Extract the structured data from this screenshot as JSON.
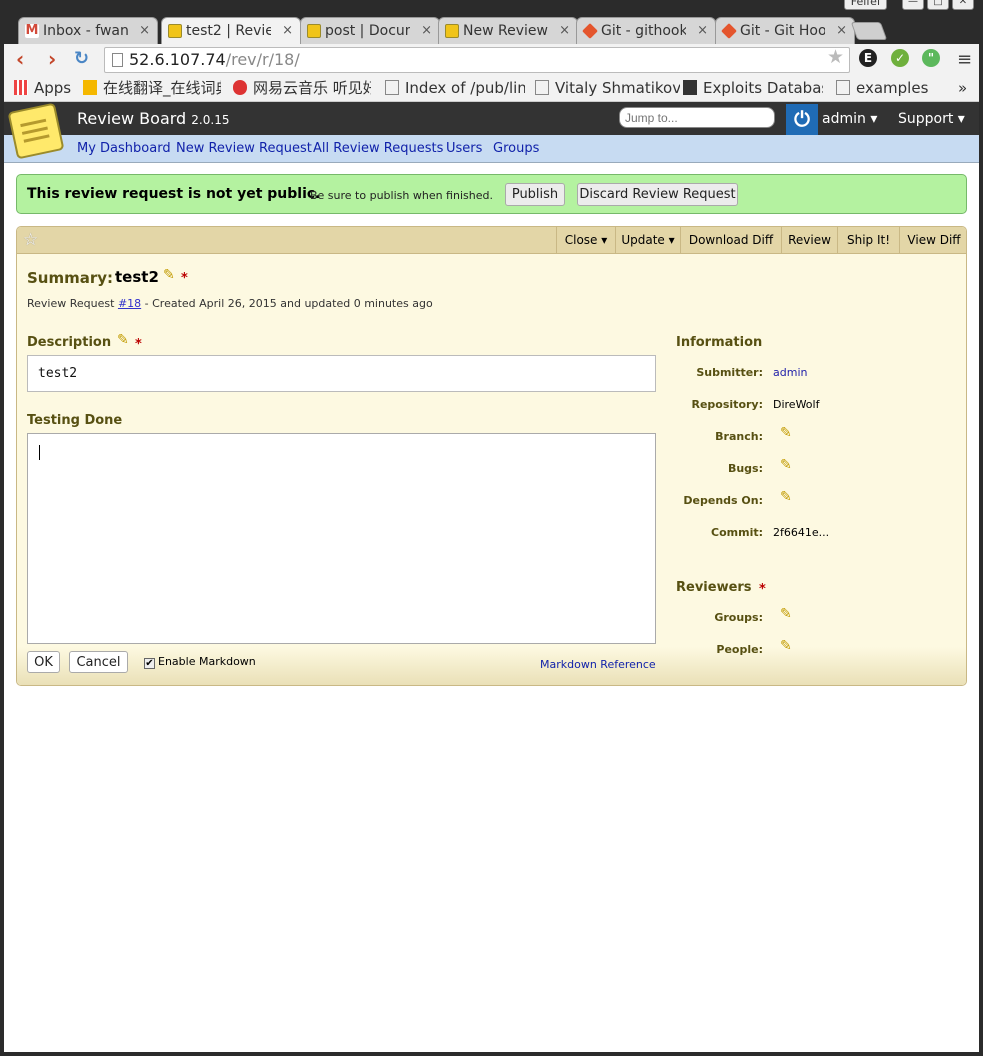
{
  "browser": {
    "window_user": "Feifei",
    "tabs": [
      {
        "title": "Inbox - fwan",
        "favicon_color": "#d24a3a",
        "favicon": "M"
      },
      {
        "title": "test2 | Revie",
        "favicon_color": "#f0c419",
        "favicon": ""
      },
      {
        "title": "post | Docum",
        "favicon_color": "#f0c419",
        "favicon": ""
      },
      {
        "title": "New Review",
        "favicon_color": "#f0c419",
        "favicon": ""
      },
      {
        "title": "Git - githook",
        "favicon_color": "#e4552d",
        "favicon": ""
      },
      {
        "title": "Git - Git Hoo",
        "favicon_color": "#e4552d",
        "favicon": ""
      }
    ],
    "close_glyph": "×",
    "url_host": "52.6.107.74",
    "url_path": "/rev/r/18/",
    "bookmarks": [
      "Apps",
      "在线翻译_在线词典",
      "网易云音乐 听见好",
      "Index of /pub/lin",
      "Vitaly Shmatikov",
      "Exploits Databas",
      "examples"
    ],
    "bookmarks_more": "»"
  },
  "header": {
    "app_name": "Review Board",
    "version": "2.0.15",
    "jump_placeholder": "Jump to...",
    "user_menu": "admin ▾",
    "support_menu": "Support ▾"
  },
  "nav": [
    "My Dashboard",
    "New Review Request",
    "All Review Requests",
    "Users",
    "Groups"
  ],
  "banner": {
    "title": "This review request is not yet public.",
    "subtitle": "Be sure to publish when finished.",
    "publish": "Publish",
    "discard": "Discard Review Request"
  },
  "actions": [
    "Close ▾",
    "Update ▾",
    "Download Diff",
    "Review",
    "Ship It!",
    "View Diff"
  ],
  "summary": {
    "label": "Summary:",
    "value": "test2",
    "required": "*",
    "rr_prefix": "Review Request",
    "rr_id": "#18",
    "rr_suffix": "- Created April 26, 2015 and updated 0 minutes ago"
  },
  "description": {
    "label": "Description",
    "required": "*",
    "value": "test2"
  },
  "testing": {
    "label": "Testing Done",
    "value": "",
    "ok": "OK",
    "cancel": "Cancel",
    "markdown": "Enable Markdown",
    "markdown_checked": "✔",
    "markdown_ref": "Markdown Reference"
  },
  "information": {
    "title": "Information",
    "submitter_label": "Submitter:",
    "submitter": "admin",
    "repository_label": "Repository:",
    "repository": "DireWolf",
    "branch_label": "Branch:",
    "bugs_label": "Bugs:",
    "depends_label": "Depends On:",
    "commit_label": "Commit:",
    "commit": "2f6641e..."
  },
  "reviewers": {
    "title": "Reviewers",
    "required": "*",
    "groups_label": "Groups:",
    "people_label": "People:"
  }
}
